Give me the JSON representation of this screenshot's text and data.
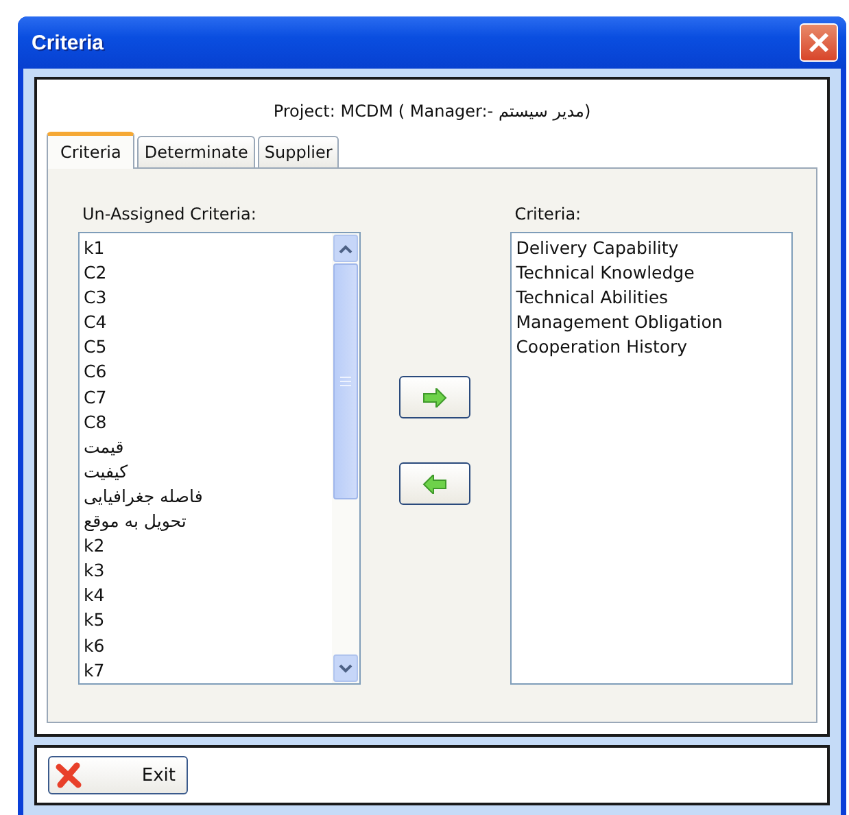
{
  "window": {
    "title": "Criteria"
  },
  "project_label": "Project: MCDM ( Manager:- مدیر سیستم)",
  "tabs": [
    {
      "label": "Criteria",
      "selected": true
    },
    {
      "label": "Determinate",
      "selected": false
    },
    {
      "label": "Supplier",
      "selected": false
    }
  ],
  "unassigned": {
    "label": "Un-Assigned Criteria:",
    "items": [
      "k1",
      "C2",
      "C3",
      "C4",
      "C5",
      "C6",
      "C7",
      "C8",
      "قیمت",
      "کیفیت",
      "فاصله جغرافیایی",
      "تحویل به موقع",
      "k2",
      "k3",
      "k4",
      "k5",
      "k6",
      "k7"
    ]
  },
  "move_buttons": [
    {
      "kind": "right"
    },
    {
      "kind": "left"
    }
  ],
  "assigned": {
    "label": "Criteria:",
    "items": [
      "Delivery Capability",
      "Technical Knowledge",
      "Technical Abilities",
      "Management Obligation",
      "Cooperation History"
    ]
  },
  "exit_button": {
    "label": "Exit"
  }
}
